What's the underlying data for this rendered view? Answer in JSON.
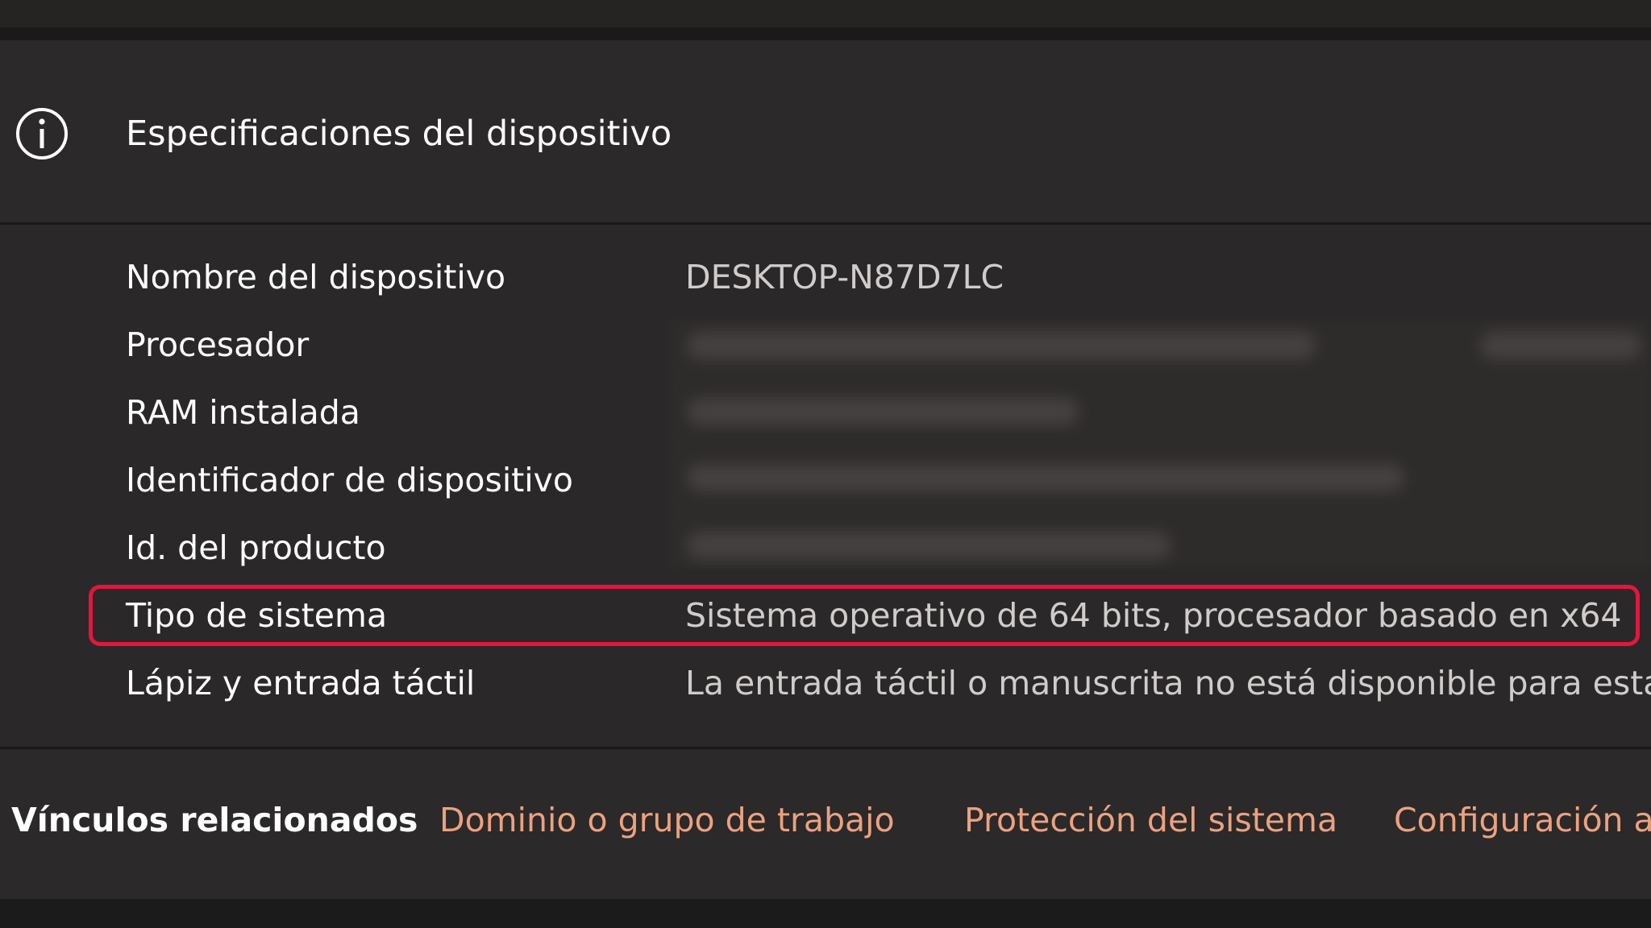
{
  "colors": {
    "background": "#201f1f",
    "card": "#2a2828",
    "value_text": "#cfcccb",
    "accent_link": "#eda17f",
    "highlight": "#e3163d"
  },
  "header": {
    "icon": "info-icon",
    "title": "Especificaciones del dispositivo"
  },
  "specs": [
    {
      "label": "Nombre del dispositivo",
      "value": "DESKTOP-N87D7LC"
    },
    {
      "label": "Procesador",
      "value": ""
    },
    {
      "label": "RAM instalada",
      "value": ""
    },
    {
      "label": "Identificador de dispositivo",
      "value": ""
    },
    {
      "label": "Id. del producto",
      "value": ""
    },
    {
      "label": "Tipo de sistema",
      "value": "Sistema operativo de 64 bits, procesador basado en x64",
      "highlighted": true
    },
    {
      "label": "Lápiz y entrada táctil",
      "value": "La entrada táctil o manuscrita no está disponible para esta"
    }
  ],
  "related_links": {
    "title": "Vínculos relacionados",
    "items": [
      "Dominio o grupo de trabajo",
      "Protección del sistema",
      "Configuración a"
    ]
  }
}
